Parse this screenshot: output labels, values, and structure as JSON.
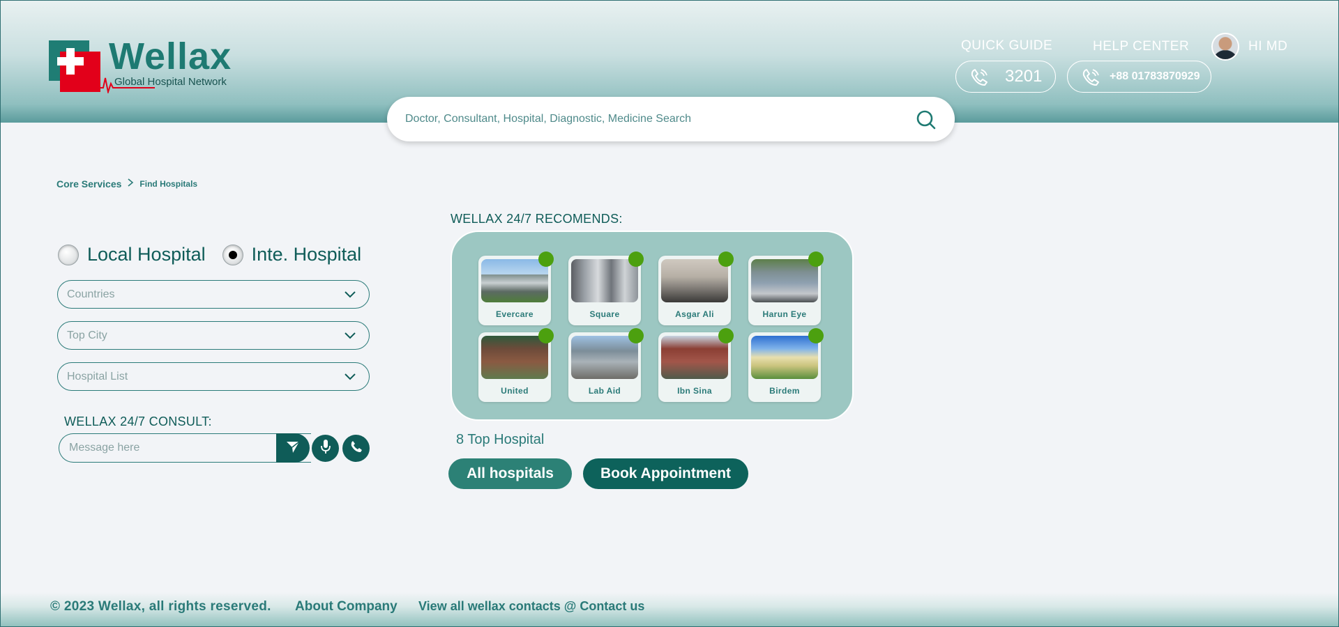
{
  "brand": {
    "name": "Wellax",
    "tagline": "Global Hospital Network",
    "primary": "#1e7a72",
    "accent": "#e2001a"
  },
  "header": {
    "quick_guide_label": "QUICK GUIDE",
    "quick_guide_number": "3201",
    "help_center_label": "HELP CENTER",
    "help_center_number": "+88 01783870929",
    "user_greeting": "HI MD"
  },
  "search": {
    "placeholder": "Doctor, Consultant, Hospital, Diagnostic, Medicine Search"
  },
  "breadcrumb": {
    "parent": "Core Services",
    "current": "Find Hospitals"
  },
  "hospital_type": {
    "options": [
      {
        "label": "Local Hospital",
        "selected": false
      },
      {
        "label": "Inte. Hospital",
        "selected": true
      }
    ]
  },
  "filters": {
    "countries": "Countries",
    "city": "Top City",
    "hospital_list": "Hospital List"
  },
  "consult": {
    "title": "WELLAX 24/7 CONSULT:",
    "placeholder": "Message here"
  },
  "recommends": {
    "title": "WELLAX 24/7 RECOMENDS:",
    "hospitals": [
      {
        "name": "Evercare"
      },
      {
        "name": "Square"
      },
      {
        "name": "Asgar Ali"
      },
      {
        "name": "Harun Eye"
      },
      {
        "name": "United"
      },
      {
        "name": "Lab Aid"
      },
      {
        "name": "Ibn Sina"
      },
      {
        "name": "Birdem"
      }
    ],
    "online_status_color": "#4ca00f",
    "count_text": "8 Top Hospital",
    "all_button": "All hospitals",
    "book_button": "Book Appointment"
  },
  "footer": {
    "copyright": "© 2023 Wellax, all rights reserved.",
    "about": "About Company",
    "contacts": "View all wellax contacts @ Contact us"
  }
}
